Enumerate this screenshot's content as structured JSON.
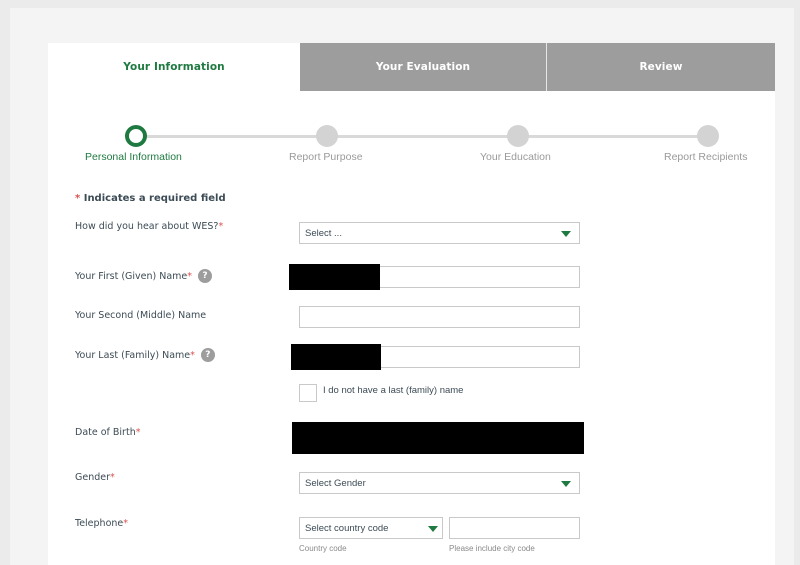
{
  "tabs": [
    {
      "label": "Your Information",
      "active": true
    },
    {
      "label": "Your Evaluation",
      "active": false
    },
    {
      "label": "Review",
      "active": false
    }
  ],
  "stepper": {
    "steps": [
      {
        "label": "Personal Information",
        "current": true
      },
      {
        "label": "Report Purpose",
        "current": false
      },
      {
        "label": "Your Education",
        "current": false
      },
      {
        "label": "Report Recipients",
        "current": false
      }
    ]
  },
  "form": {
    "required_note_star": "*",
    "required_note": "Indicates a required field",
    "fields": {
      "hear_about": {
        "label": "How did you hear about WES?",
        "required_star": "*",
        "value": "Select ..."
      },
      "first_name": {
        "label": "Your First (Given) Name",
        "required_star": "*",
        "help": "?"
      },
      "middle_name": {
        "label": "Your Second (Middle) Name"
      },
      "last_name": {
        "label": "Your Last (Family) Name",
        "required_star": "*",
        "help": "?"
      },
      "no_last_name": {
        "label": "I do not have a last (family) name",
        "checked": false
      },
      "dob": {
        "label": "Date of Birth",
        "required_star": "*"
      },
      "gender": {
        "label": "Gender",
        "required_star": "*",
        "value": "Select Gender"
      },
      "telephone": {
        "label": "Telephone",
        "required_star": "*",
        "country_value": "Select country code",
        "country_hint": "Country code",
        "number_hint": "Please include city code"
      }
    }
  },
  "colors": {
    "accent": "#1f7a41",
    "tab_inactive": "#9d9d9d",
    "required": "#d9534f"
  }
}
